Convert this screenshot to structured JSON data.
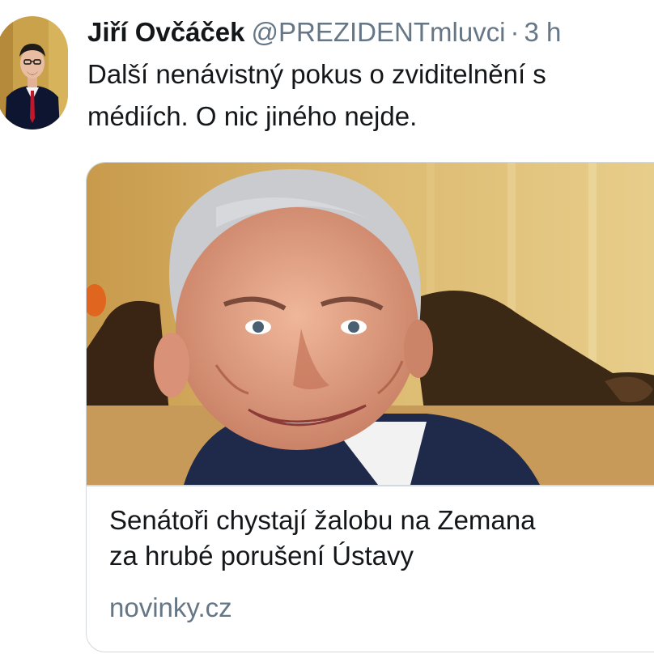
{
  "tweet": {
    "author_name": "Jiří Ovčáček",
    "author_handle": "@PREZIDENTmluvci",
    "separator": "·",
    "time": "3 h",
    "text_lines": [
      "Další nenávistný pokus o zviditelnění s",
      "médiích. O nic jiného nejde."
    ]
  },
  "link_card": {
    "title_lines": [
      "Senátoři chystají žalobu na Zemana",
      "za hrubé porušení Ústavy"
    ],
    "domain": "novinky.cz"
  },
  "colors": {
    "text_primary": "#14171a",
    "text_secondary": "#657786",
    "card_border": "#d2dadf",
    "background": "#ffffff"
  }
}
